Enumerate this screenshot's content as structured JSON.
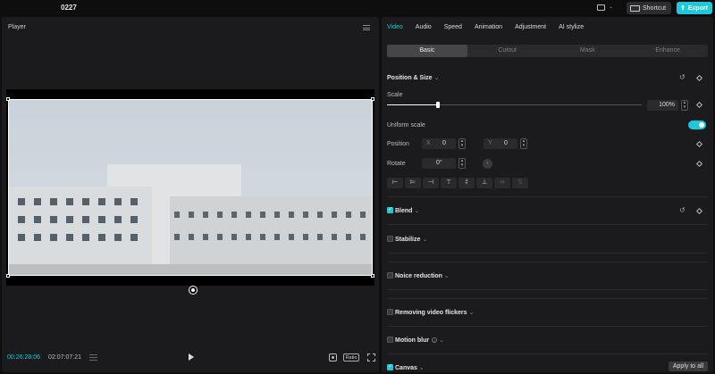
{
  "topbar": {
    "project_title": "0227",
    "shortcut_label": "Shortcut",
    "export_label": "Export"
  },
  "player": {
    "title": "Player",
    "current_time": "00:26:28:06",
    "total_time": "02:07:07:21",
    "ratio_label": "Ratio"
  },
  "panel": {
    "tabs": [
      "Video",
      "Audio",
      "Speed",
      "Animation",
      "Adjustment",
      "AI stylize"
    ],
    "active_tab": "Video",
    "subtabs": [
      "Basic",
      "Cutout",
      "Mask",
      "Enhance"
    ],
    "active_subtab": "Basic",
    "position_size": {
      "title": "Position & Size",
      "scale_label": "Scale",
      "scale_value": "100%",
      "scale_fraction": 0.2,
      "uniform_scale_label": "Uniform scale",
      "uniform_scale_on": true,
      "position_label": "Position",
      "x_label": "X",
      "x_value": "0",
      "y_label": "Y",
      "y_value": "0",
      "rotate_label": "Rotate",
      "rotate_value": "0°",
      "rotate_dial": "-"
    },
    "sections": {
      "blend": "Blend",
      "stabilize": "Stabilize",
      "noise_reduction": "Noice reduction",
      "video_flickers": "Removing video flickers",
      "motion_blur": "Motion blur",
      "canvas": "Canvas"
    },
    "apply_all_label": "Apply to all"
  },
  "colors": {
    "accent": "#1ec8d8",
    "background": "#0f0f10",
    "panel": "#1b1b1d"
  }
}
